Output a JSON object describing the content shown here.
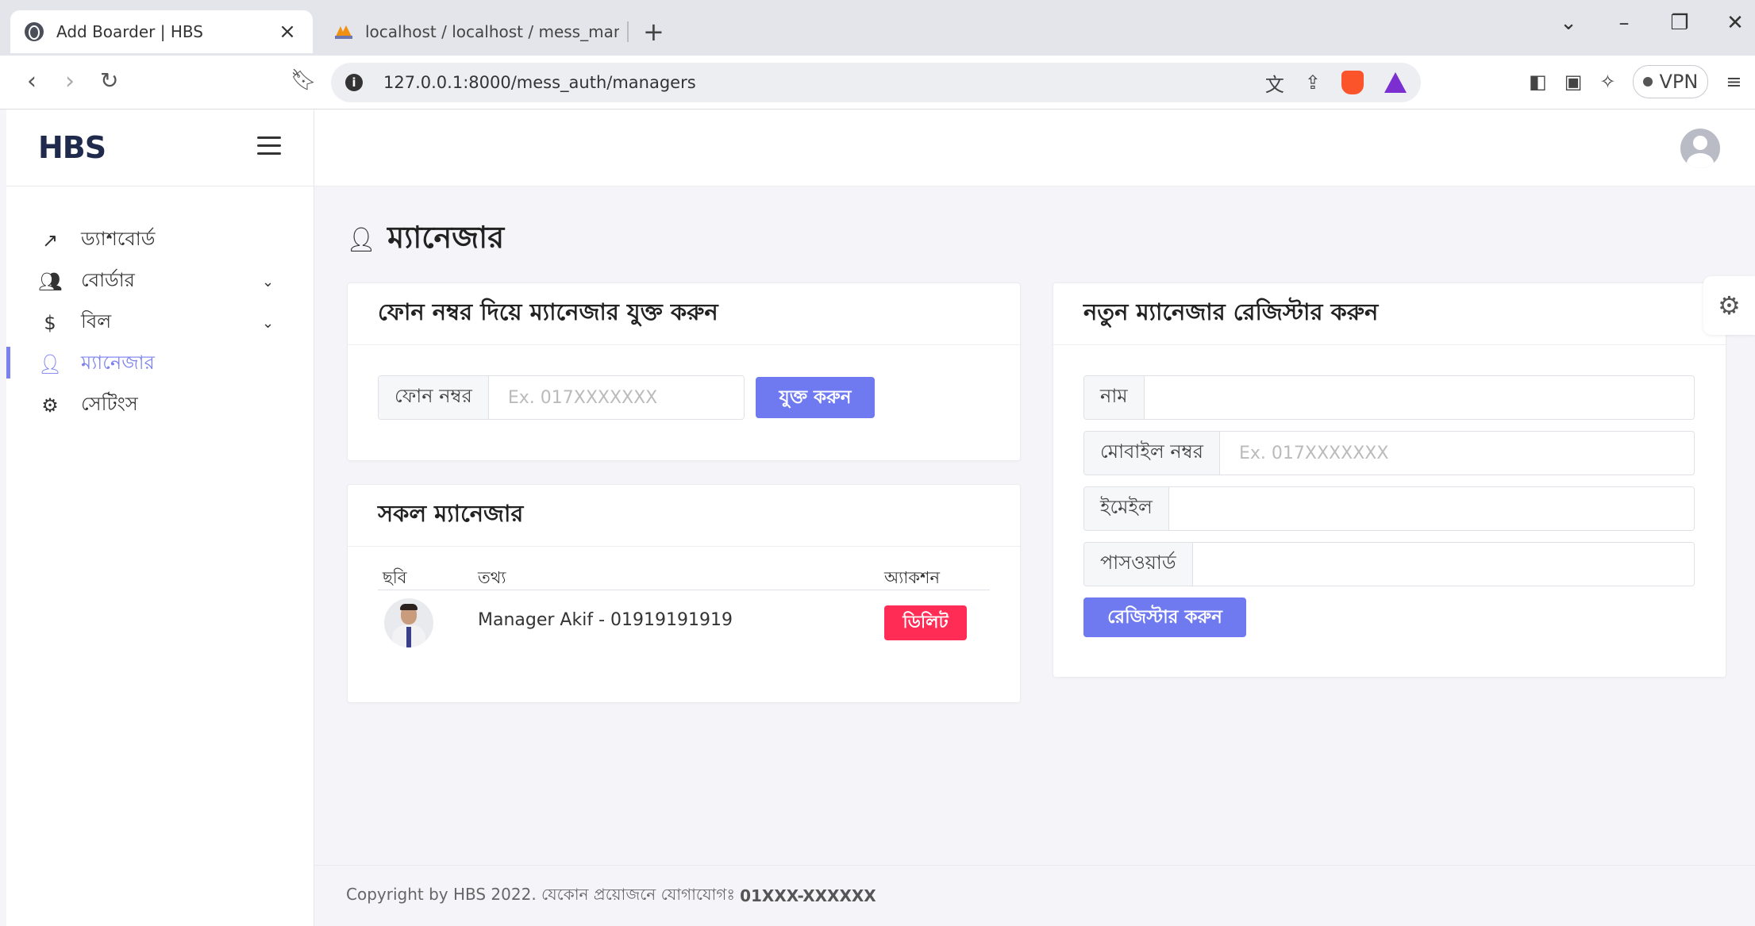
{
  "browser": {
    "active_tab_title": "Add Boarder | HBS",
    "second_tab_title": "localhost / localhost / mess_manage",
    "url": "127.0.0.1:8000/mess_auth/managers",
    "vpn_label": "VPN"
  },
  "app": {
    "logo": "HBS",
    "brand_color": "#1f2a4d",
    "accent_color": "#6f79f0"
  },
  "sidebar": {
    "items": [
      {
        "label": "ড্যাশবোর্ড",
        "icon": "trending-up-icon"
      },
      {
        "label": "বোর্ডার",
        "icon": "users-icon"
      },
      {
        "label": "বিল",
        "icon": "dollar-icon"
      },
      {
        "label": "ম্যানেজার",
        "icon": "user-check-icon"
      },
      {
        "label": "সেটিংস",
        "icon": "gear-icon"
      }
    ]
  },
  "page": {
    "title": "ম্যানেজার"
  },
  "add_card": {
    "title": "ফোন নম্বর দিয়ে ম্যানেজার যুক্ত করুন",
    "phone_label": "ফোন নম্বর",
    "phone_placeholder": "Ex. 017XXXXXXX",
    "submit_label": "যুক্ত করুন"
  },
  "list_card": {
    "title": "সকল ম্যানেজার",
    "columns": [
      "ছবি",
      "তথ্য",
      "অ্যাকশন"
    ],
    "rows": [
      {
        "info": "Manager Akif - 01919191919",
        "action_label": "ডিলিট"
      }
    ]
  },
  "register_card": {
    "title": "নতুন ম্যানেজার রেজিস্টার করুন",
    "name_label": "নাম",
    "mobile_label": "মোবাইল নম্বর",
    "mobile_placeholder": "Ex. 017XXXXXXX",
    "email_label": "ইমেইল",
    "password_label": "পাসওয়ার্ড",
    "submit_label": "রেজিস্টার করুন"
  },
  "footer": {
    "text": "Copyright by HBS 2022. যেকোন প্রয়োজনে যোগাযোগঃ",
    "phone": "01XXX-XXXXXX"
  }
}
